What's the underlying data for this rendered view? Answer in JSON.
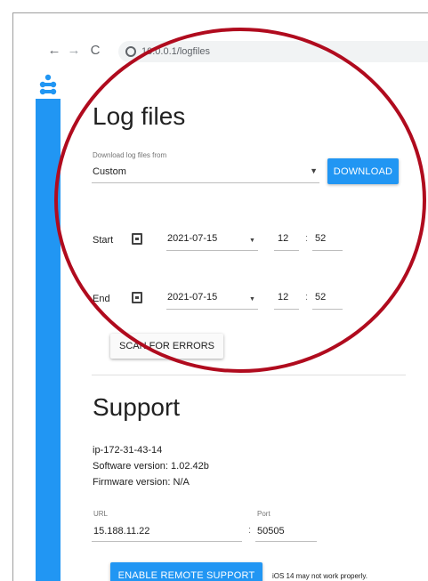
{
  "browser": {
    "url": "10.0.0.1/logfiles",
    "back_icon": "←",
    "forward_icon": "→",
    "reload_icon": "C"
  },
  "logfiles": {
    "title": "Log files",
    "source_label": "Download log files from",
    "source_value": "Custom",
    "download_label": "DOWNLOAD",
    "start_label": "Start",
    "start_date": "2021-07-15",
    "start_hour": "12",
    "start_minute": "52",
    "end_label": "End",
    "end_date": "2021-07-15",
    "end_hour": "12",
    "end_minute": "52",
    "time_sep": ":",
    "scan_label": "SCAN FOR ERRORS"
  },
  "support": {
    "title": "Support",
    "hostname": "ip-172-31-43-14",
    "software_version": "Software version: 1.02.42b",
    "firmware_version": "Firmware version: N/A",
    "url_label": "URL",
    "url_value": "15.188.11.22",
    "port_label": "Port",
    "port_value": "50505",
    "port_sep": ":",
    "enable_label": "ENABLE REMOTE SUPPORT",
    "ios_note": "iOS 14 may not work properly."
  },
  "colors": {
    "accent": "#2196f3",
    "annotation": "#b00b1e"
  }
}
